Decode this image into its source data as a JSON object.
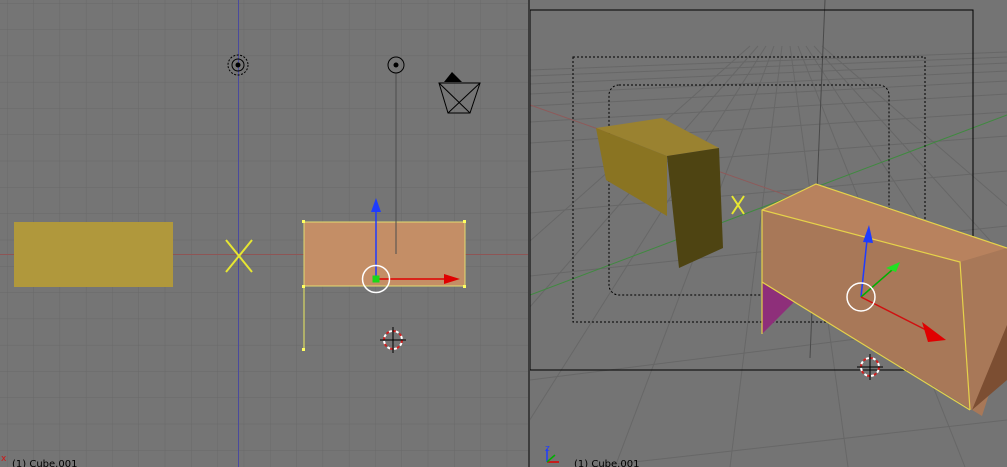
{
  "viewports": [
    {
      "id": "front-ortho",
      "label": "(1) Cube.001",
      "axis_marker": "x"
    },
    {
      "id": "camera-perspective",
      "label": "(1) Cube.001",
      "axis_marker": "z"
    }
  ],
  "colors": {
    "background": "#757575",
    "grid": "#6b6b6b",
    "mustard_object": "#b0983c",
    "selected_object": "#c48e66",
    "selection_outline": "#f0f050",
    "lamp": "#000000",
    "axis_x": "#e00000",
    "axis_y": "#00b000",
    "axis_z": "#1e3cff"
  },
  "icons": [
    "lamp-icon",
    "camera-icon",
    "empty-cross-icon",
    "3d-cursor-icon",
    "manipulator-widget-icon",
    "axis-widget-icon"
  ]
}
